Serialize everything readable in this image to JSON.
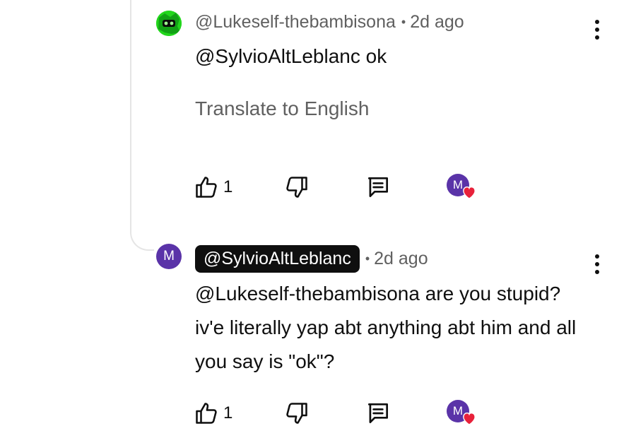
{
  "comments": [
    {
      "avatar_letter": "",
      "avatar_color": "#22d61c",
      "author": "@Lukeself-thebambisona",
      "time": "2d ago",
      "text": "@SylvioAltLeblanc ok",
      "translate_label": "Translate to English",
      "like_count": "1"
    },
    {
      "avatar_letter": "M",
      "avatar_color": "#5a33a8",
      "author": "@SylvioAltLeblanc",
      "time": "2d ago",
      "text": "@Lukeself-thebambisona are you stupid? iv'e literally yap abt anything abt him and all you say is \"ok\"?",
      "like_count": "1"
    }
  ],
  "creator_heart": {
    "avatar_letter": "M",
    "avatar_color": "#5a33a8",
    "heart_color": "#e8213a"
  },
  "icons": [
    "like-icon",
    "dislike-icon",
    "reply-icon",
    "more-vert-icon",
    "heart-icon"
  ]
}
